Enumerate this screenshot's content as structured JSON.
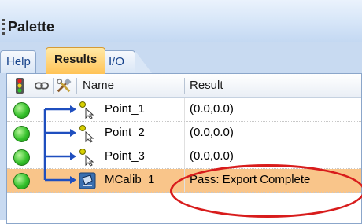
{
  "palette": {
    "title": "Palette",
    "tabs": [
      {
        "label": "Help",
        "active": false
      },
      {
        "label": "Results",
        "active": true
      },
      {
        "label": "I/O",
        "active": false
      }
    ]
  },
  "grid": {
    "columns": {
      "status_icon": "traffic-light-icon",
      "link_icon": "link-icon",
      "tools_icon": "tools-icon",
      "name": "Name",
      "result": "Result"
    },
    "rows": [
      {
        "status": "green",
        "icon": "point-icon",
        "name": "Point_1",
        "result": "(0.0,0.0)",
        "selected": false
      },
      {
        "status": "green",
        "icon": "point-icon",
        "name": "Point_2",
        "result": "(0.0,0.0)",
        "selected": false
      },
      {
        "status": "green",
        "icon": "point-icon",
        "name": "Point_3",
        "result": "(0.0,0.0)",
        "selected": false
      },
      {
        "status": "green",
        "icon": "calibration-icon",
        "name": "MCalib_1",
        "result": "Pass: Export Complete",
        "selected": true
      }
    ]
  },
  "colors": {
    "selected_row": "#f9c58a",
    "active_tab": "#ffc356",
    "status_ok": "#35c12b",
    "highlight_oval": "#d81c1c"
  }
}
